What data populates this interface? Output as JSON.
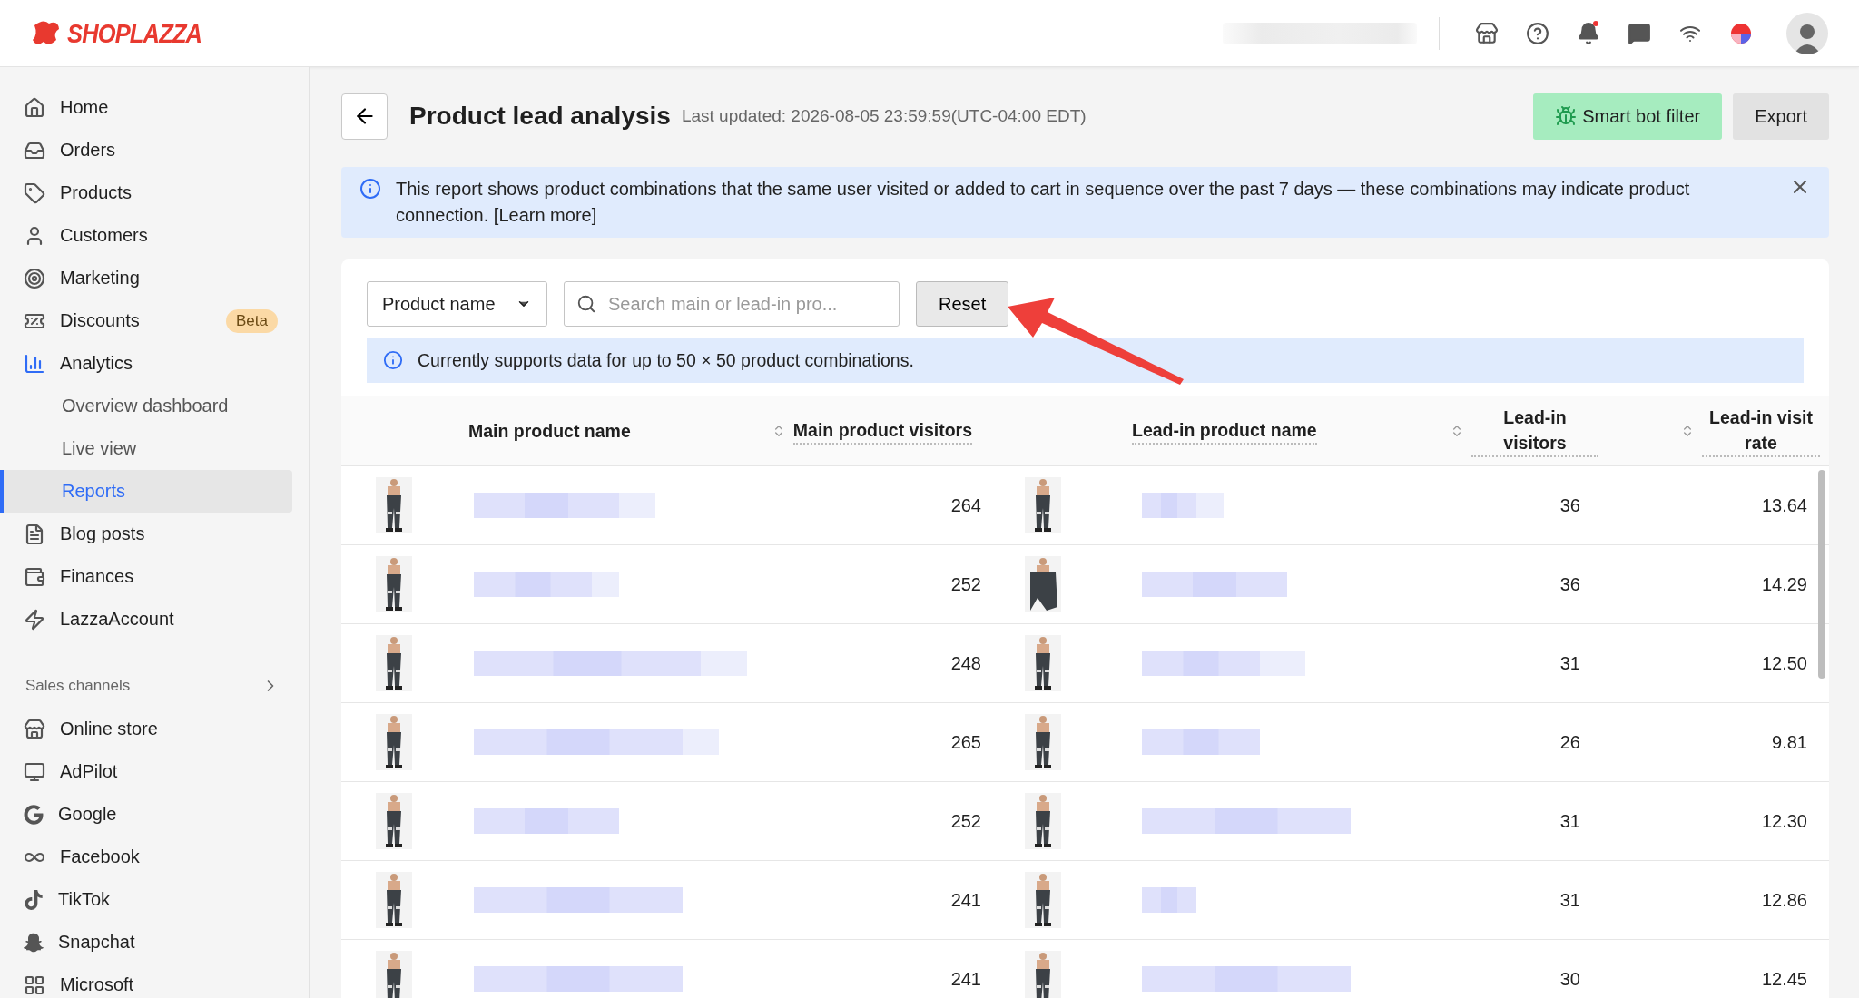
{
  "topbar": {
    "logo": "SHOPLAZZA"
  },
  "sidebar": {
    "items": [
      {
        "label": "Home",
        "selected": false
      },
      {
        "label": "Orders",
        "selected": false
      },
      {
        "label": "Products",
        "selected": false
      },
      {
        "label": "Customers",
        "selected": false
      },
      {
        "label": "Marketing",
        "selected": false
      },
      {
        "label": "Discounts",
        "selected": false,
        "badge": "Beta"
      },
      {
        "label": "Analytics",
        "selected": false,
        "children": [
          {
            "label": "Overview dashboard",
            "selected": false
          },
          {
            "label": "Live view",
            "selected": false
          },
          {
            "label": "Reports",
            "selected": true
          }
        ]
      },
      {
        "label": "Blog posts",
        "selected": false
      },
      {
        "label": "Finances",
        "selected": false
      },
      {
        "label": "LazzaAccount",
        "selected": false
      }
    ],
    "section": {
      "title": "Sales channels",
      "items": [
        {
          "label": "Online store",
          "selected": false
        },
        {
          "label": "AdPilot",
          "selected": false
        },
        {
          "label": "Google",
          "selected": false
        },
        {
          "label": "Facebook",
          "selected": false
        },
        {
          "label": "TikTok",
          "selected": false
        },
        {
          "label": "Snapchat",
          "selected": false
        },
        {
          "label": "Microsoft",
          "selected": false
        }
      ]
    }
  },
  "header": {
    "title": "Product lead analysis",
    "updated": "Last updated: 2026-08-05 23:59:59(UTC-04:00 EDT)",
    "buttons": [
      {
        "label": "Smart bot filter",
        "kind": "primary"
      },
      {
        "label": "Export",
        "kind": "secondary"
      }
    ]
  },
  "alert": {
    "text": "This report shows product combinations that the same user visited or added to cart in sequence over the past 7 days — these combinations may indicate product connection. [Learn more]"
  },
  "filters": {
    "select": "Product name",
    "search_placeholder": "Search main or lead-in pro...",
    "reset": "Reset"
  },
  "notice": "Currently supports data for up to 50 × 50 product combinations.",
  "table": {
    "columns": [
      {
        "label": "Main product name",
        "sortable": false,
        "hint": false
      },
      {
        "label": "Main product visitors",
        "sortable": true,
        "hint": true
      },
      {
        "label": "Lead-in product name",
        "sortable": false,
        "hint": true
      },
      {
        "label": "Lead-in visitors",
        "sortable": true,
        "hint": true
      },
      {
        "label": "Lead-in visit rate",
        "sortable": true,
        "hint": true
      }
    ],
    "rows": [
      {
        "main_visitors": "264",
        "lead_visitors": "36",
        "rate": "13.64"
      },
      {
        "main_visitors": "252",
        "lead_visitors": "36",
        "rate": "14.29"
      },
      {
        "main_visitors": "248",
        "lead_visitors": "31",
        "rate": "12.50"
      },
      {
        "main_visitors": "265",
        "lead_visitors": "26",
        "rate": "9.81"
      },
      {
        "main_visitors": "252",
        "lead_visitors": "31",
        "rate": "12.30"
      },
      {
        "main_visitors": "241",
        "lead_visitors": "31",
        "rate": "12.86"
      },
      {
        "main_visitors": "241",
        "lead_visitors": "30",
        "rate": "12.45"
      }
    ]
  }
}
